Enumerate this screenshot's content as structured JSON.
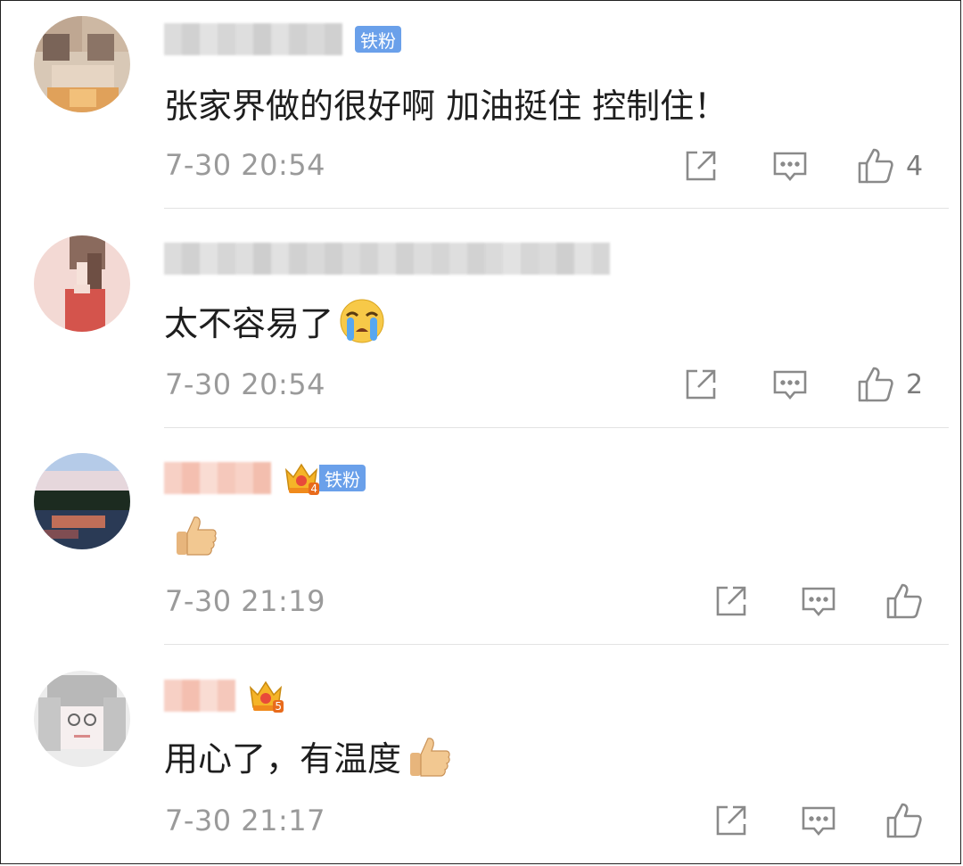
{
  "badges": {
    "fan": "铁粉"
  },
  "crown_levels": {
    "c3": "4",
    "c4": "5"
  },
  "comments": [
    {
      "text": "张家界做的很好啊 加油挺住 控制住！",
      "time": "7-30 20:54",
      "likes": "4"
    },
    {
      "text": "太不容易了",
      "emoji": "crying-face",
      "time": "7-30 20:54",
      "likes": "2"
    },
    {
      "text": "",
      "emoji": "thumbs-up",
      "time": "7-30 21:19",
      "likes": ""
    },
    {
      "text": "用心了，有温度",
      "emoji": "thumbs-up",
      "time": "7-30 21:17",
      "likes": ""
    }
  ],
  "colors": {
    "badge": "#6aa0ea",
    "text": "#1e1e1e",
    "meta": "#9a9a9a",
    "icon": "#8a8a8a"
  }
}
